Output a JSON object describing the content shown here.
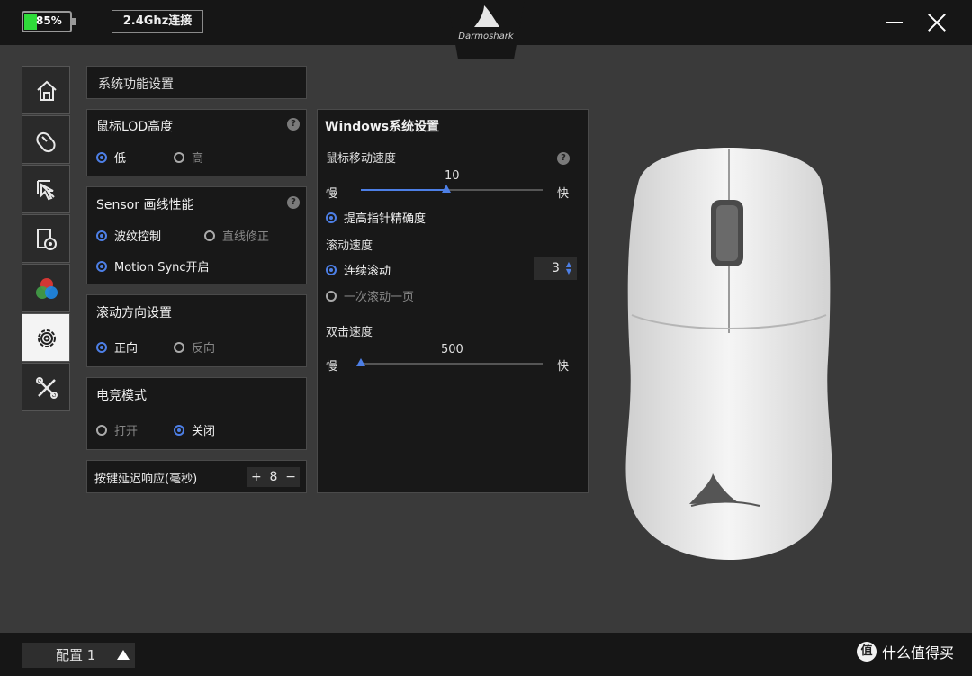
{
  "titlebar": {
    "battery_label": "85%",
    "connection_label": "2.4Ghz连接",
    "brand": "Darmoshark"
  },
  "nav": {
    "items": [
      {
        "name": "home",
        "icon": "home-icon",
        "active": false
      },
      {
        "name": "buttons",
        "icon": "mouse-icon",
        "active": false
      },
      {
        "name": "macro",
        "icon": "cursor-click-icon",
        "active": false
      },
      {
        "name": "dpi",
        "icon": "document-gear-icon",
        "active": false
      },
      {
        "name": "lighting",
        "icon": "rgb-icon",
        "active": false
      },
      {
        "name": "settings",
        "icon": "gear-icon",
        "active": true
      },
      {
        "name": "tools",
        "icon": "tools-icon",
        "active": false
      }
    ]
  },
  "system": {
    "header": "系统功能设置",
    "lod": {
      "title": "鼠标LOD高度",
      "help": "?",
      "options": [
        "低",
        "高"
      ],
      "selected": "低"
    },
    "sensor": {
      "title": "Sensor 画线性能",
      "help": "?",
      "option1": "波纹控制",
      "option2": "直线修正",
      "option3": "Motion Sync开启"
    },
    "scroll_dir": {
      "title": "滚动方向设置",
      "options": [
        "正向",
        "反向"
      ],
      "selected": "正向"
    },
    "esports": {
      "title": "电竞模式",
      "options": [
        "打开",
        "关闭"
      ],
      "selected": "关闭"
    },
    "debounce": {
      "label": "按键延迟响应(毫秒)",
      "plus": "+",
      "value": "8",
      "minus": "−"
    }
  },
  "windows": {
    "title": "Windows系统设置",
    "pointer_speed": {
      "label": "鼠标移动速度",
      "help": "?",
      "value": "10",
      "min_label": "慢",
      "max_label": "快",
      "fraction": 0.47
    },
    "precision": "提高指针精确度",
    "scroll_speed": {
      "label": "滚动速度",
      "continuous": "连续滚动",
      "page": "一次滚动一页",
      "value": "3"
    },
    "double_click": {
      "label": "双击速度",
      "value": "500",
      "min_label": "慢",
      "max_label": "快",
      "fraction": 0.0
    }
  },
  "bottombar": {
    "profile_label": "配置 1",
    "watermark_badge": "值",
    "watermark_text": "什么值得买"
  }
}
